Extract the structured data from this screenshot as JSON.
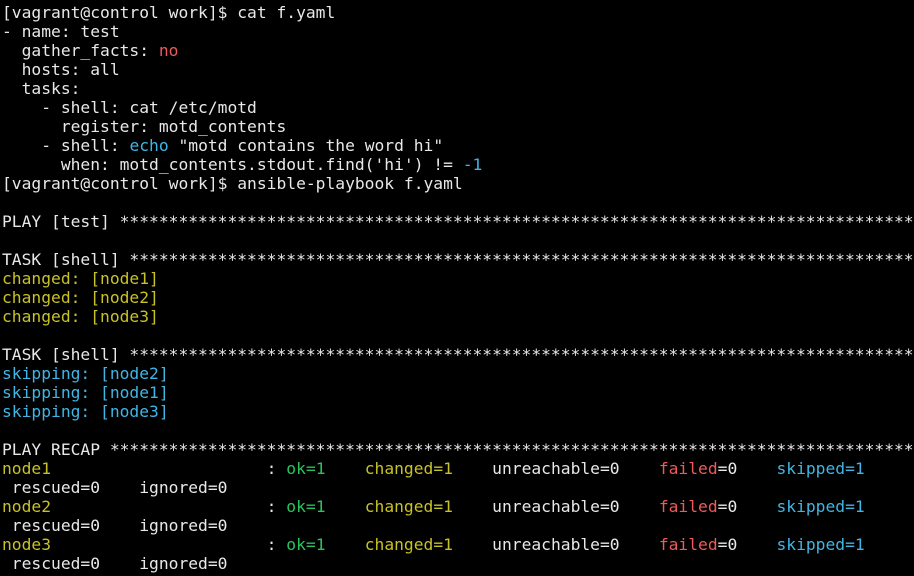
{
  "terminal": {
    "lines": [
      [
        {
          "t": "[vagrant@control work]$ cat f.yaml",
          "c": "white"
        }
      ],
      [
        {
          "t": "- name: test",
          "c": "white"
        }
      ],
      [
        {
          "t": "  gather_facts: ",
          "c": "white"
        },
        {
          "t": "no",
          "c": "red"
        }
      ],
      [
        {
          "t": "  hosts: all",
          "c": "white"
        }
      ],
      [
        {
          "t": "  tasks:",
          "c": "white"
        }
      ],
      [
        {
          "t": "    - shell: cat /etc/motd",
          "c": "white"
        }
      ],
      [
        {
          "t": "      register: motd_contents",
          "c": "white"
        }
      ],
      [
        {
          "t": "    - shell: ",
          "c": "white"
        },
        {
          "t": "echo",
          "c": "cyan"
        },
        {
          "t": " \"motd contains the word hi\"",
          "c": "white"
        }
      ],
      [
        {
          "t": "      when: motd_contents.stdout.find('hi') != ",
          "c": "white"
        },
        {
          "t": "-1",
          "c": "cyan"
        }
      ],
      [
        {
          "t": "[vagrant@control work]$ ansible-playbook f.yaml",
          "c": "white"
        }
      ],
      [],
      [
        {
          "t": "PLAY [test] ***************************************************************************************",
          "c": "white"
        }
      ],
      [],
      [
        {
          "t": "TASK [shell] **************************************************************************************",
          "c": "white"
        }
      ],
      [
        {
          "t": "changed: [node1]",
          "c": "yellow"
        }
      ],
      [
        {
          "t": "changed: [node2]",
          "c": "yellow"
        }
      ],
      [
        {
          "t": "changed: [node3]",
          "c": "yellow"
        }
      ],
      [],
      [
        {
          "t": "TASK [shell] **************************************************************************************",
          "c": "white"
        }
      ],
      [
        {
          "t": "skipping: [node2]",
          "c": "cyan"
        }
      ],
      [
        {
          "t": "skipping: [node1]",
          "c": "cyan"
        }
      ],
      [
        {
          "t": "skipping: [node3]",
          "c": "cyan"
        }
      ],
      [],
      [
        {
          "t": "PLAY RECAP ****************************************************************************************",
          "c": "white"
        }
      ],
      [
        {
          "t": "node1",
          "c": "yellow"
        },
        {
          "t": "                      : ",
          "c": "white"
        },
        {
          "t": "ok=1",
          "c": "green"
        },
        {
          "t": "    ",
          "c": "white"
        },
        {
          "t": "changed=1",
          "c": "yellow"
        },
        {
          "t": "    unreachable=0    ",
          "c": "white"
        },
        {
          "t": "failed",
          "c": "red"
        },
        {
          "t": "=0    ",
          "c": "white"
        },
        {
          "t": "skipped=1",
          "c": "cyan"
        }
      ],
      [
        {
          "t": " rescued=0    ignored=0",
          "c": "white"
        }
      ],
      [
        {
          "t": "node2",
          "c": "yellow"
        },
        {
          "t": "                      : ",
          "c": "white"
        },
        {
          "t": "ok=1",
          "c": "green"
        },
        {
          "t": "    ",
          "c": "white"
        },
        {
          "t": "changed=1",
          "c": "yellow"
        },
        {
          "t": "    unreachable=0    ",
          "c": "white"
        },
        {
          "t": "failed",
          "c": "red"
        },
        {
          "t": "=0    ",
          "c": "white"
        },
        {
          "t": "skipped=1",
          "c": "cyan"
        }
      ],
      [
        {
          "t": " rescued=0    ignored=0",
          "c": "white"
        }
      ],
      [
        {
          "t": "node3",
          "c": "yellow"
        },
        {
          "t": "                      : ",
          "c": "white"
        },
        {
          "t": "ok=1",
          "c": "green"
        },
        {
          "t": "    ",
          "c": "white"
        },
        {
          "t": "changed=1",
          "c": "yellow"
        },
        {
          "t": "    unreachable=0    ",
          "c": "white"
        },
        {
          "t": "failed",
          "c": "red"
        },
        {
          "t": "=0    ",
          "c": "white"
        },
        {
          "t": "skipped=1",
          "c": "cyan"
        }
      ],
      [
        {
          "t": " rescued=0    ignored=0",
          "c": "white"
        }
      ]
    ]
  },
  "colors": {
    "background": "#000000",
    "text": "#e8e8e8",
    "red": "#ee5a5a",
    "cyan": "#3fb6e6",
    "yellow": "#c8c225",
    "green": "#27c45a"
  }
}
